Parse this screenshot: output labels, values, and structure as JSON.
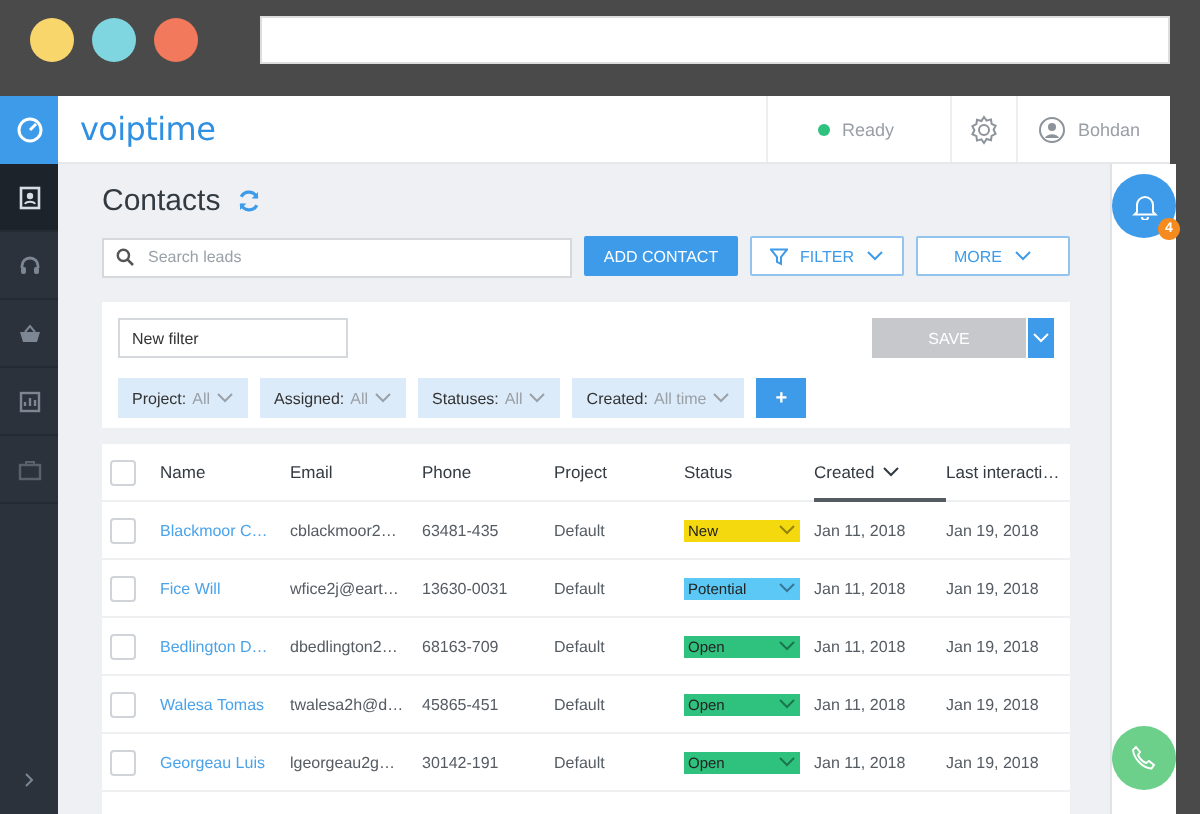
{
  "window": {
    "controls": [
      {
        "color": "#f9d66b"
      },
      {
        "color": "#7fd6e0"
      },
      {
        "color": "#f2795c"
      }
    ]
  },
  "sidebar": {
    "items": [
      {
        "kind": "contacts",
        "selected": true
      },
      {
        "kind": "headset",
        "selected": false
      },
      {
        "kind": "basket",
        "selected": false
      },
      {
        "kind": "report",
        "selected": false
      },
      {
        "kind": "briefcase",
        "selected": false
      }
    ]
  },
  "header": {
    "logo": "voiptime",
    "status": {
      "label": "Ready",
      "online": true
    },
    "user": "Bohdan"
  },
  "notifications": {
    "count": "4"
  },
  "page": {
    "title": "Contacts",
    "search": {
      "placeholder": "Search leads"
    },
    "actions": [
      {
        "label": "ADD CONTACT",
        "kind": "primary"
      },
      {
        "label": "FILTER",
        "kind": "filter"
      },
      {
        "label": "MORE",
        "kind": "menu"
      }
    ]
  },
  "filter": {
    "name": "New filter",
    "save": {
      "label": "SAVE",
      "disabled": true
    },
    "chips": [
      {
        "label": "Project:",
        "value": "All"
      },
      {
        "label": "Assigned:",
        "value": "All"
      },
      {
        "label": "Statuses:",
        "value": "All"
      },
      {
        "label": "Created:",
        "value": "All time"
      }
    ],
    "add": "+"
  },
  "table": {
    "select_all": {
      "checked": false
    },
    "columns": [
      {
        "label": "Name",
        "sorted": false
      },
      {
        "label": "Email",
        "sorted": false
      },
      {
        "label": "Phone",
        "sorted": false
      },
      {
        "label": "Project",
        "sorted": false
      },
      {
        "label": "Status",
        "sorted": false
      },
      {
        "label": "Created",
        "sorted": true
      },
      {
        "label": "Last interacti…",
        "sorted": false
      }
    ],
    "rows": [
      {
        "checked": false,
        "name": "Blackmoor C…",
        "email": "cblackmoor2…",
        "phone": "63481-435",
        "project": "Default",
        "status": {
          "label": "New",
          "color": "#f5d90f"
        },
        "created": "Jan 11, 2018",
        "last_interaction": "Jan 19, 2018"
      },
      {
        "checked": false,
        "name": "Fice Will",
        "email": "wfice2j@eart…",
        "phone": "13630-0031",
        "project": "Default",
        "status": {
          "label": "Potential",
          "color": "#5bc8f5"
        },
        "created": "Jan 11, 2018",
        "last_interaction": "Jan 19, 2018"
      },
      {
        "checked": false,
        "name": "Bedlington D…",
        "email": "dbedlington2…",
        "phone": "68163-709",
        "project": "Default",
        "status": {
          "label": "Open",
          "color": "#2ec27e"
        },
        "created": "Jan 11, 2018",
        "last_interaction": "Jan 19, 2018"
      },
      {
        "checked": false,
        "name": "Walesa Tomas",
        "email": "twalesa2h@d…",
        "phone": "45865-451",
        "project": "Default",
        "status": {
          "label": "Open",
          "color": "#2ec27e"
        },
        "created": "Jan 11, 2018",
        "last_interaction": "Jan 19, 2018"
      },
      {
        "checked": false,
        "name": "Georgeau Luis",
        "email": "lgeorgeau2g…",
        "phone": "30142-191",
        "project": "Default",
        "status": {
          "label": "Open",
          "color": "#2ec27e"
        },
        "created": "Jan 11, 2018",
        "last_interaction": "Jan 19, 2018"
      }
    ]
  }
}
